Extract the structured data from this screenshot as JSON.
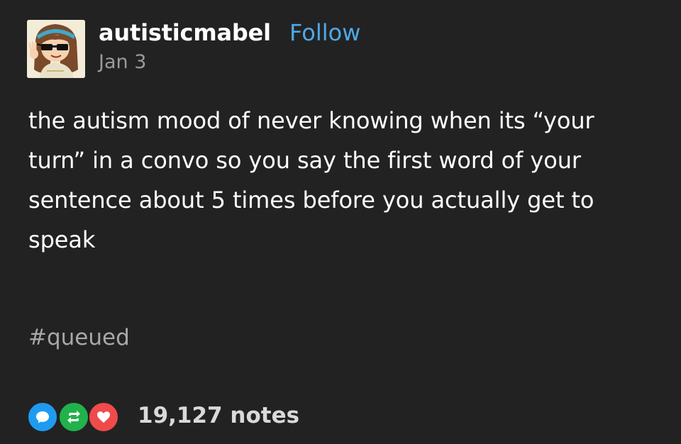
{
  "post": {
    "username": "autisticmabel",
    "follow_label": "Follow",
    "date": "Jan 3",
    "body": "the autism mood of never knowing when its “your turn” in a convo so you say the first word of your sentence about 5 times before you actually get to speak",
    "tag": "#queued",
    "notes": "19,127 notes"
  },
  "icons": {
    "reply": "speech-bubble-icon",
    "reblog": "reblog-icon",
    "like": "heart-icon"
  },
  "colors": {
    "background": "#222222",
    "follow": "#4fa8e8",
    "reply": "#1e9bf0",
    "reblog": "#21b24b",
    "like": "#ef4b4b"
  }
}
